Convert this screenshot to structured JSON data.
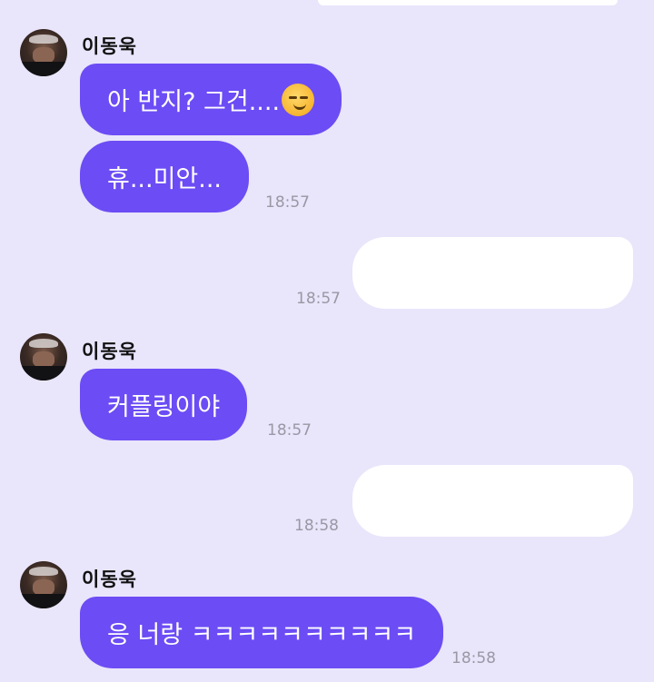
{
  "sender_name": "이동욱",
  "messages": [
    {
      "text": "아 반지? 그건....",
      "emoji": "smirking-face"
    },
    {
      "text": "휴...미안...",
      "time": "18:57"
    },
    {
      "time": "18:57"
    },
    {
      "text": "커플링이야",
      "time": "18:57"
    },
    {
      "time": "18:58"
    },
    {
      "text": "응 너랑 ㅋㅋㅋㅋㅋㅋㅋㅋㅋㅋ",
      "time": "18:58"
    }
  ],
  "colors": {
    "background": "#e9e5fb",
    "incoming_bubble": "#6c4cf4",
    "outgoing_bubble": "#ffffff",
    "timestamp": "#9a98a4"
  }
}
